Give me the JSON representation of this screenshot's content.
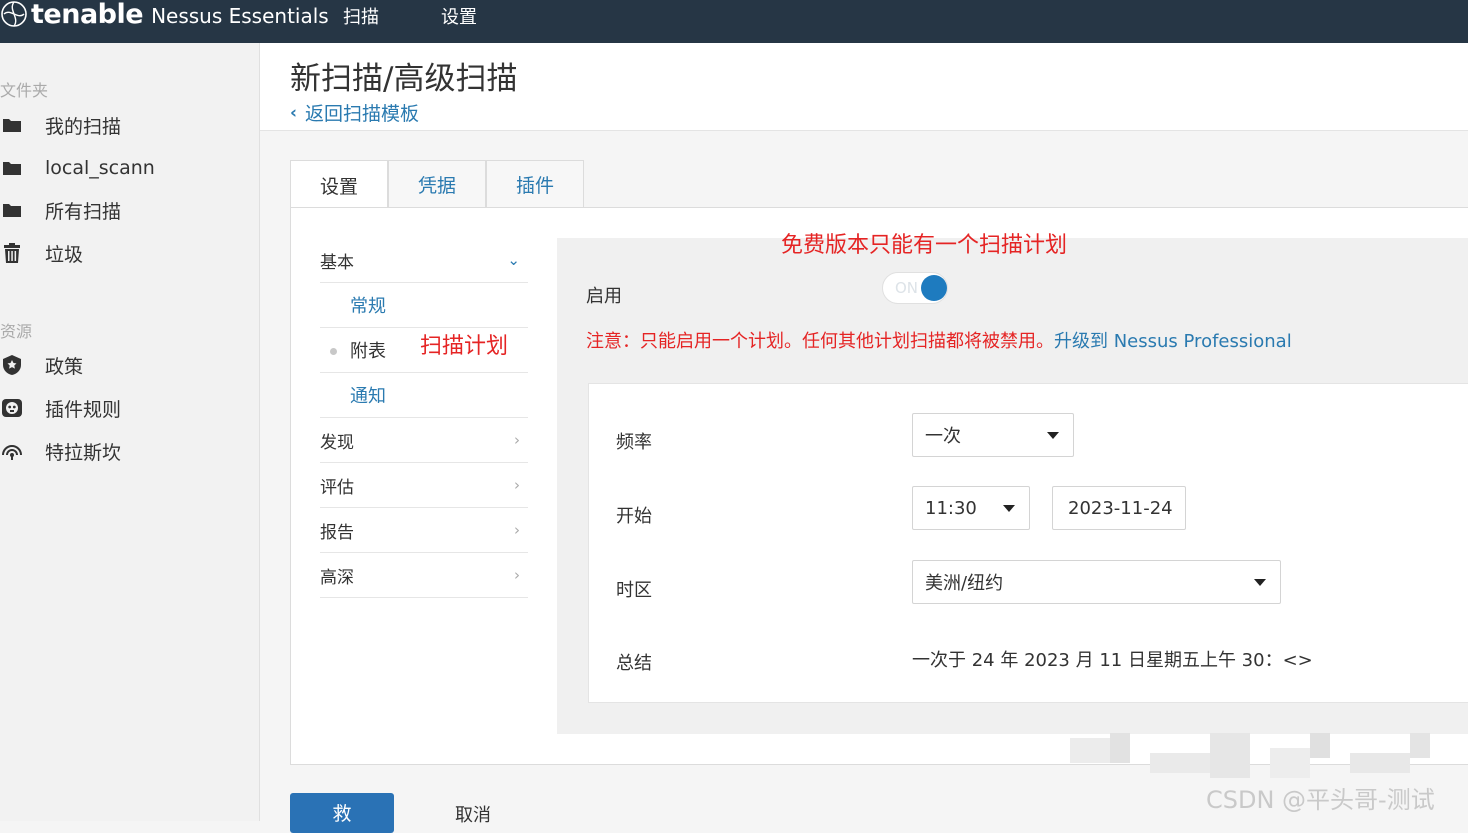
{
  "app": {
    "brand": "tenable",
    "product": "Nessus Essentials",
    "nav": [
      "扫描",
      "设置"
    ]
  },
  "sidebar": {
    "folders_heading": "文件夹",
    "folders": [
      {
        "label": "我的扫描",
        "icon": "folder-icon"
      },
      {
        "label": "local_scann",
        "icon": "folder-icon"
      },
      {
        "label": "所有扫描",
        "icon": "folder-icon"
      },
      {
        "label": "垃圾",
        "icon": "trash-icon"
      }
    ],
    "resources_heading": "资源",
    "resources": [
      {
        "label": "政策",
        "icon": "shield-icon"
      },
      {
        "label": "插件规则",
        "icon": "plugin-rules-icon"
      },
      {
        "label": "特拉斯坎",
        "icon": "signal-icon"
      }
    ]
  },
  "page": {
    "title": "新扫描/高级扫描",
    "back_link": "返回扫描模板"
  },
  "tabs": [
    "设置",
    "凭据",
    "插件"
  ],
  "left_menu": {
    "basic": "基本",
    "basic_items": [
      "常规",
      "附表",
      "通知"
    ],
    "sections": [
      "发现",
      "评估",
      "报告",
      "高深"
    ]
  },
  "annotations": {
    "top": "免费版本只能有一个扫描计划",
    "left": "扫描计划"
  },
  "schedule": {
    "enable_label": "启用",
    "toggle_text": "ON",
    "toggle_on": true,
    "notice": "注意：只能启用一个计划。任何其他计划扫描都将被禁用。",
    "upgrade_link": "升级到 Nessus Professional",
    "frequency_label": "频率",
    "frequency_value": "一次",
    "start_label": "开始",
    "start_time": "11:30",
    "start_date": "2023-11-24",
    "timezone_label": "时区",
    "timezone_value": "美洲/纽约",
    "summary_label": "总结",
    "summary_value": "一次于 24 年 2023 月 11 日星期五上午 30：<>"
  },
  "actions": {
    "save": "救",
    "cancel": "取消"
  },
  "watermark": "CSDN @平头哥-测试",
  "colors": {
    "topbar": "#263645",
    "link": "#2a7ab0",
    "accent": "#1e7bbf",
    "annotation": "#e52424"
  }
}
